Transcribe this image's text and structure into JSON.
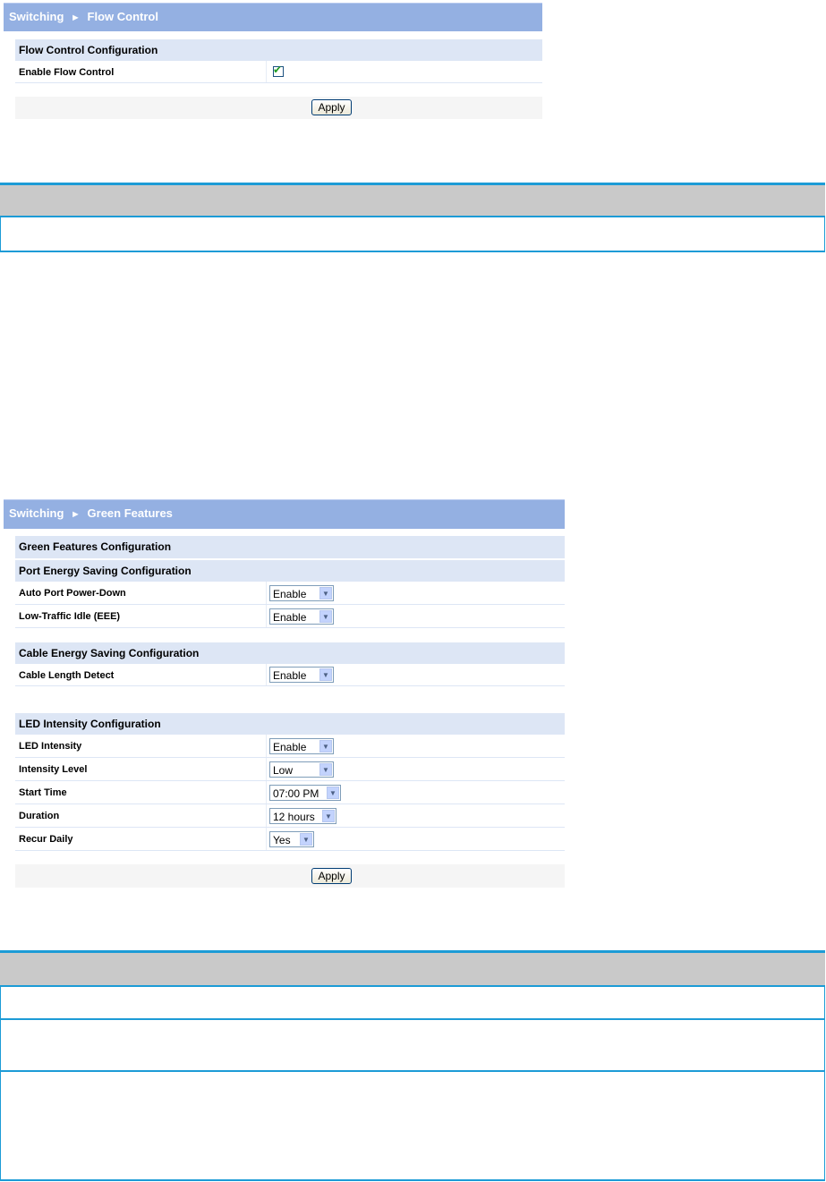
{
  "flow_control": {
    "header": {
      "section": "Switching",
      "separator": "►",
      "page": "Flow Control"
    },
    "config_title": "Flow Control Configuration",
    "enable_label": "Enable Flow Control",
    "enable_checked": true,
    "apply_label": "Apply"
  },
  "green_features": {
    "header": {
      "section": "Switching",
      "separator": "►",
      "page": "Green Features"
    },
    "config_title": "Green Features Configuration",
    "port_section": "Port Energy Saving Configuration",
    "auto_port_label": "Auto Port Power-Down",
    "auto_port_value": "Enable",
    "low_traffic_label": "Low-Traffic Idle (EEE)",
    "low_traffic_value": "Enable",
    "cable_section": "Cable Energy Saving Configuration",
    "cable_length_label": "Cable Length Detect",
    "cable_length_value": "Enable",
    "led_section": "LED Intensity Configuration",
    "led_intensity_label": "LED Intensity",
    "led_intensity_value": "Enable",
    "intensity_level_label": "Intensity Level",
    "intensity_level_value": "Low",
    "start_time_label": "Start Time",
    "start_time_value": "07:00 PM",
    "duration_label": "Duration",
    "duration_value": "12 hours",
    "recur_label": "Recur Daily",
    "recur_value": "Yes",
    "apply_label": "Apply"
  },
  "colors": {
    "header_blue": "#94b0e2",
    "section_blue": "#dde6f5",
    "doc_border": "#1c9bd6",
    "doc_head": "#c9c9c9"
  }
}
